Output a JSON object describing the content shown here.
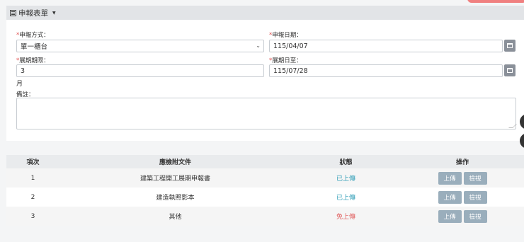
{
  "card": {
    "title": "申報表單"
  },
  "form": {
    "method_label": "申報方式：",
    "method_value": "單一櫃台",
    "date_label": "申報日期：",
    "date_value": "115/04/07",
    "period_label": "展期期限：",
    "period_value": "3",
    "period_unit": "月",
    "until_label": "展期日至：",
    "until_value": "115/07/28",
    "remark_label": "備註：",
    "required_mark": "*"
  },
  "table": {
    "headers": [
      "項次",
      "應檢附文件",
      "狀態",
      "操作"
    ],
    "rows": [
      {
        "no": "1",
        "doc": "建築工程開工展期申報書",
        "status": "已上傳",
        "status_type": "ok"
      },
      {
        "no": "2",
        "doc": "建造執照影本",
        "status": "已上傳",
        "status_type": "ok"
      },
      {
        "no": "3",
        "doc": "其他",
        "status": "免上傳",
        "status_type": "no"
      }
    ],
    "upload_label": "上傳",
    "view_label": "檢視"
  },
  "colors": {
    "ok": "#2a9bb5",
    "no": "#e05a5a",
    "button": "#9aaebc",
    "calendar": "#8a9099"
  }
}
